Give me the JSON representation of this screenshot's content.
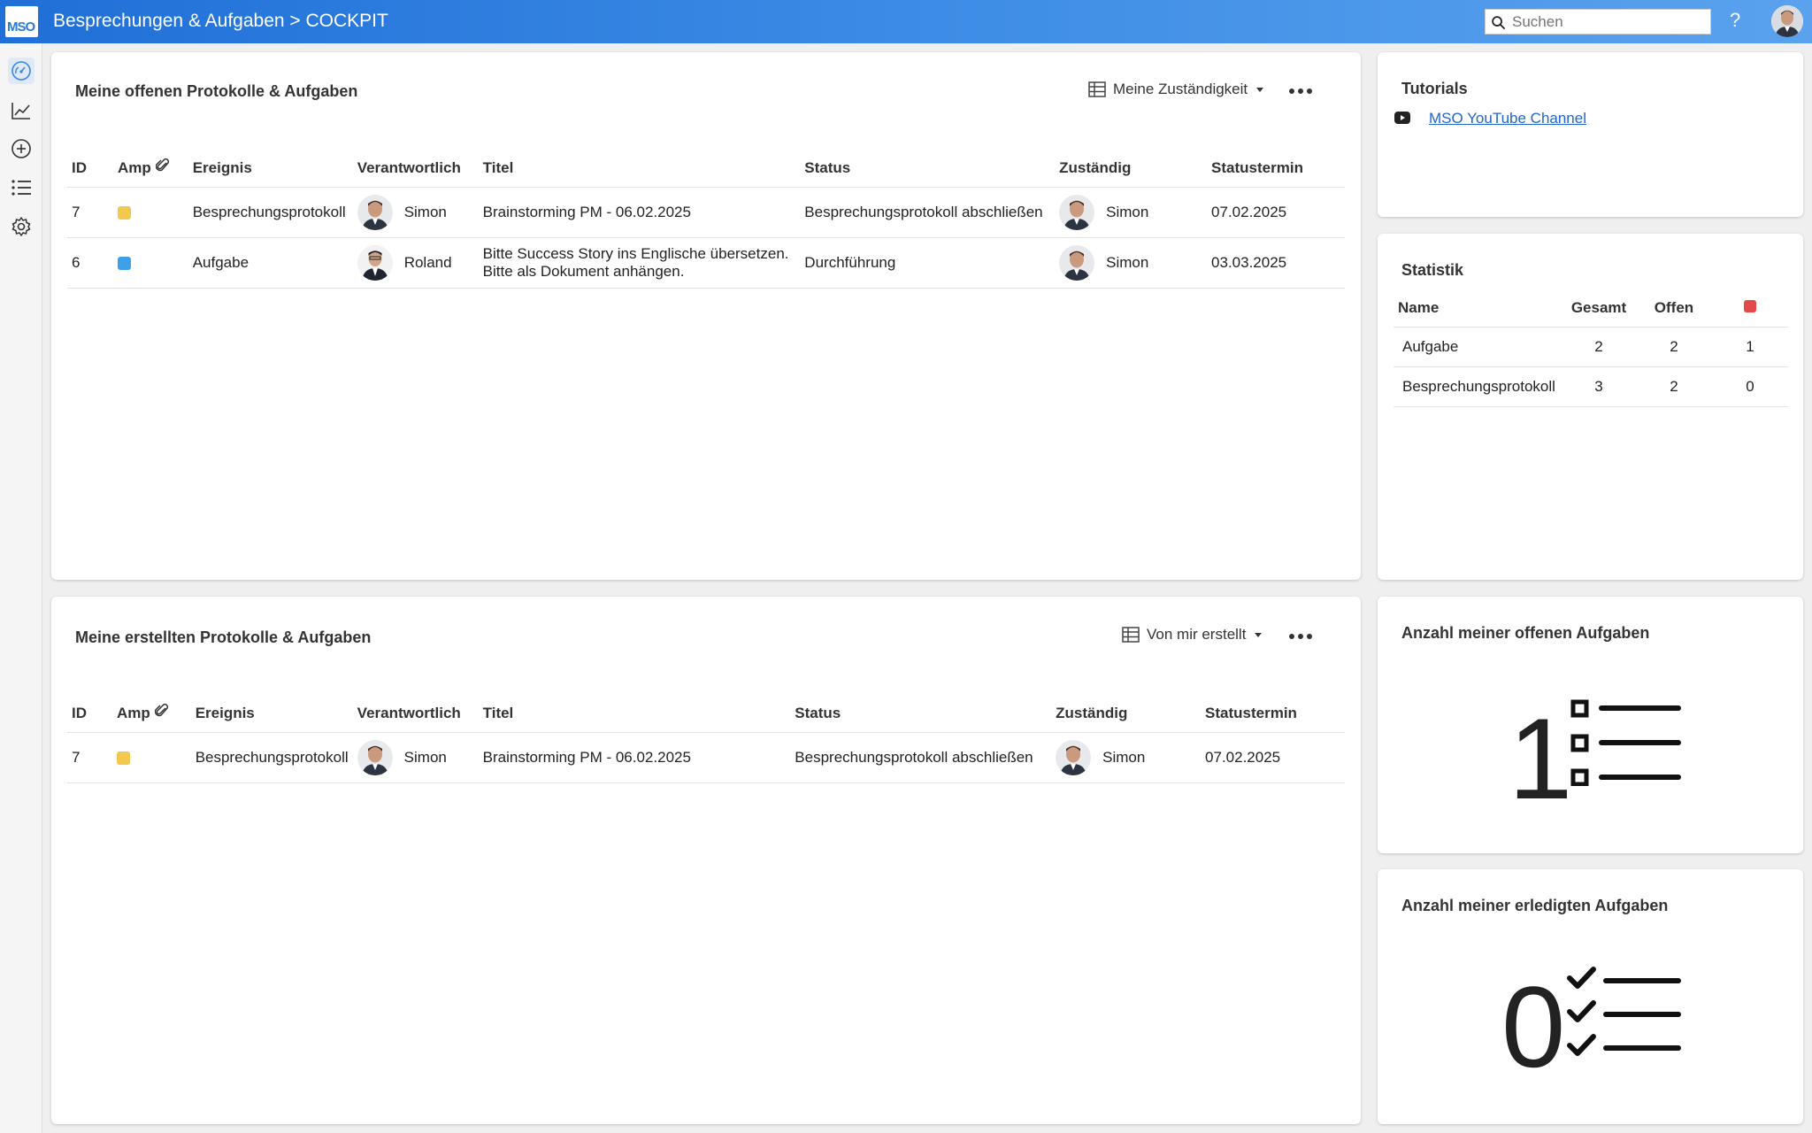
{
  "header": {
    "logo_text": "MSO",
    "title": "Besprechungen & Aufgaben > COCKPIT",
    "search_placeholder": "Suchen",
    "help": "?"
  },
  "colors": {
    "amp_yellow": "#f2c94c",
    "amp_blue": "#3fa0ea",
    "status_red": "#e04a4a",
    "accent": "#2a7ad8"
  },
  "rail": {
    "icons": [
      "dashboard-icon",
      "chart-line-icon",
      "add-circle-icon",
      "list-icon",
      "settings-icon"
    ]
  },
  "open_panel": {
    "title": "Meine offenen Protokolle & Aufgaben",
    "filter_label": "Meine Zuständigkeit",
    "columns": {
      "id": "ID",
      "amp": "Amp",
      "ereignis": "Ereignis",
      "verantwortlich": "Verantwortlich",
      "titel": "Titel",
      "status": "Status",
      "zustaendig": "Zuständig",
      "statustermin": "Statustermin"
    },
    "rows": [
      {
        "id": "7",
        "ereignis": "Besprechungsprotokoll",
        "verantwortlich": "Simon",
        "titel": "Brainstorming PM - 06.02.2025",
        "titel2": "",
        "status": "Besprechungsprotokoll abschließen",
        "zustaendig": "Simon",
        "statustermin": "07.02.2025"
      },
      {
        "id": "6",
        "ereignis": "Aufgabe",
        "verantwortlich": "Roland",
        "titel": "Bitte Success Story ins Englische übersetzen.",
        "titel2": "Bitte als Dokument anhängen.",
        "status": "Durchführung",
        "zustaendig": "Simon",
        "statustermin": "03.03.2025"
      }
    ]
  },
  "created_panel": {
    "title": "Meine erstellten Protokolle & Aufgaben",
    "filter_label": "Von mir erstellt",
    "columns": {
      "id": "ID",
      "amp": "Amp",
      "ereignis": "Ereignis",
      "verantwortlich": "Verantwortlich",
      "titel": "Titel",
      "status": "Status",
      "zustaendig": "Zuständig",
      "statustermin": "Statustermin"
    },
    "rows": [
      {
        "id": "7",
        "ereignis": "Besprechungsprotokoll",
        "verantwortlich": "Simon",
        "titel": "Brainstorming PM - 06.02.2025",
        "status": "Besprechungsprotokoll abschließen",
        "zustaendig": "Simon",
        "statustermin": "07.02.2025"
      }
    ]
  },
  "tutorials": {
    "title": "Tutorials",
    "link": "MSO YouTube Channel"
  },
  "statistik": {
    "title": "Statistik",
    "columns": {
      "name": "Name",
      "gesamt": "Gesamt",
      "offen": "Offen"
    },
    "rows": [
      {
        "name": "Aufgabe",
        "gesamt": "2",
        "offen": "2",
        "overdue": "1"
      },
      {
        "name": "Besprechungsprotokoll",
        "gesamt": "3",
        "offen": "2",
        "overdue": "0"
      }
    ]
  },
  "open_count": {
    "title": "Anzahl meiner offenen Aufgaben",
    "value": "1"
  },
  "done_count": {
    "title": "Anzahl meiner erledigten Aufgaben",
    "value": "0"
  }
}
